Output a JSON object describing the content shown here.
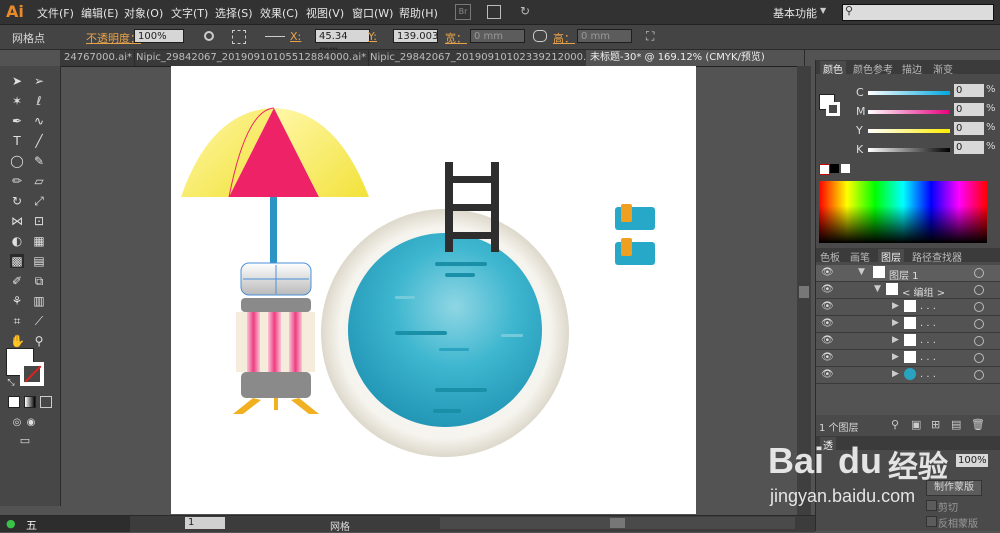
{
  "app": {
    "logo": "Ai",
    "workspace": "基本功能",
    "workspace_arrow": "▼"
  },
  "menu": [
    "文件(F)",
    "编辑(E)",
    "对象(O)",
    "文字(T)",
    "选择(S)",
    "效果(C)",
    "视图(V)",
    "窗口(W)",
    "帮助(H)"
  ],
  "menu_extra": {
    "br": "Br"
  },
  "controlbar": {
    "mode_label": "网格点",
    "opacity_label": "不透明度：",
    "opacity_value": "100%",
    "x_label": "X:",
    "x_value": "45.34 mm",
    "y_label": "Y:",
    "y_value": "139.003",
    "w_label": "宽：",
    "w_value": "0 mm",
    "h_label": "高：",
    "h_value": "0 mm"
  },
  "tabs": [
    {
      "label": "24767000.ai*",
      "active": false
    },
    {
      "label": "Nipic_29842067_20190910105512884000.ai*",
      "active": false
    },
    {
      "label": "Nipic_29842067_20190910102339212000.ai*",
      "active": false
    },
    {
      "label": "未标题-30* @ 169.12% (CMYK/预览)",
      "active": true
    }
  ],
  "color_panel": {
    "tabs": [
      "颜色",
      "颜色参考",
      "描边",
      "渐变"
    ],
    "channels": [
      {
        "label": "C",
        "value": "0"
      },
      {
        "label": "M",
        "value": "0"
      },
      {
        "label": "Y",
        "value": "0"
      },
      {
        "label": "K",
        "value": "0"
      }
    ],
    "pct": "%"
  },
  "layers_panel": {
    "tabs": [
      "色板",
      "画笔",
      "图层",
      "路径查找器"
    ],
    "rows": [
      {
        "label": "图层 1"
      },
      {
        "label": "< 编组 >"
      },
      {
        "label": ". . ."
      },
      {
        "label": ". . ."
      },
      {
        "label": ". . ."
      },
      {
        "label": ". . ."
      },
      {
        "label": ". . ."
      }
    ],
    "count": "1 个图层"
  },
  "transparency_panel": {
    "title": "透",
    "opacity": "100%",
    "make_mask": "制作蒙版",
    "clip": "剪切",
    "invert": "反相蒙版"
  },
  "statusbar": {
    "page": "1",
    "tool": "网格"
  },
  "watermark": {
    "brand": "Bai",
    "brand2": "du",
    "cn": "经验",
    "url": "jingyan.baidu.com"
  },
  "colors": {
    "umbrella_yellow": "#f7ea5a",
    "umbrella_pink": "#ee2266",
    "pool_blue": "#2aa3c0",
    "pool_rim": "#ece8df",
    "ladder": "#2e2e2e",
    "accent_orange": "#f0a020",
    "accent_cyan": "#27a8c8",
    "light_pink": "#f37aa8",
    "gray": "#8a8a8a"
  }
}
